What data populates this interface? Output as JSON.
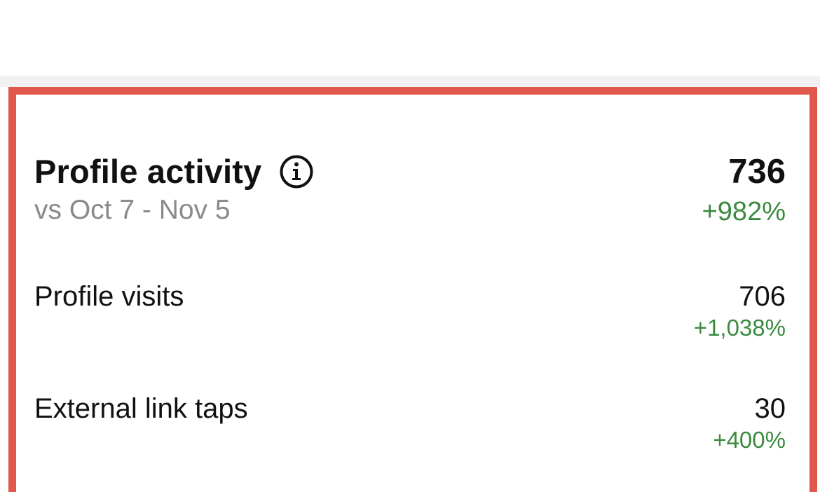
{
  "colors": {
    "highlight_border": "#e2574c",
    "positive_change": "#3a8a3f",
    "muted_text": "#8a8a8a",
    "primary_text": "#111111"
  },
  "profile_activity": {
    "title": "Profile activity",
    "info_icon": "info-icon",
    "comparison_range": "vs Oct 7 - Nov 5",
    "total": "736",
    "total_change": "+982%",
    "metrics": [
      {
        "label": "Profile visits",
        "value": "706",
        "change": "+1,038%"
      },
      {
        "label": "External link taps",
        "value": "30",
        "change": "+400%"
      }
    ]
  }
}
